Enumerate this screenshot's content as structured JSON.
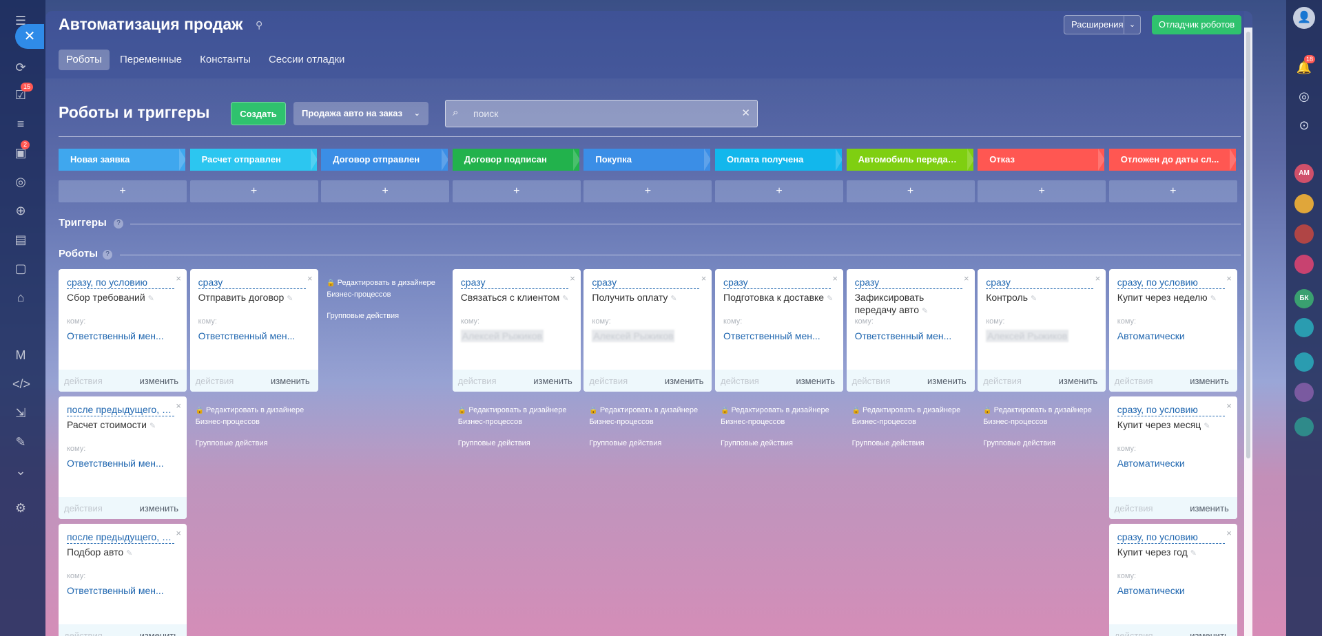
{
  "portal": {
    "close_label": "✕",
    "left_badges": [
      "15",
      "2"
    ],
    "right_badge": "18",
    "right_avatars": [
      "АМ",
      "БК"
    ]
  },
  "header": {
    "title": "Автоматизация продаж",
    "extensions_label": "Расширения",
    "debugger_label": "Отладчик роботов",
    "tabs": [
      {
        "label": "Роботы",
        "active": true
      },
      {
        "label": "Переменные"
      },
      {
        "label": "Константы"
      },
      {
        "label": "Сессии отладки"
      }
    ]
  },
  "toolbar": {
    "section_title": "Роботы и триггеры",
    "create_label": "Создать",
    "category_label": "Продажа авто на заказ",
    "search_placeholder": "поиск"
  },
  "stages": [
    {
      "label": "Новая заявка",
      "color": "#3fa7ee"
    },
    {
      "label": "Расчет отправлен",
      "color": "#2cc6f0"
    },
    {
      "label": "Договор отправлен",
      "color": "#3b8ee6"
    },
    {
      "label": "Договор подписан",
      "color": "#22b24c"
    },
    {
      "label": "Покупка",
      "color": "#3b8ee6"
    },
    {
      "label": "Оплата получена",
      "color": "#12b7ec"
    },
    {
      "label": "Автомобиль передан к...",
      "color": "#7fcf11"
    },
    {
      "label": "Отказ",
      "color": "#ff5752"
    },
    {
      "label": "Отложен до даты сл...",
      "color": "#ff5752"
    }
  ],
  "add_label": "+",
  "sections": {
    "triggers": "Триггеры",
    "robots": "Роботы",
    "help": "?"
  },
  "card_ui": {
    "komu": "кому:",
    "actions": "действия",
    "change": "изменить",
    "delete": "×",
    "edit": "✎"
  },
  "bp_link": "Редактировать в дизайнере Бизнес-процессов",
  "group_link": "Групповые действия",
  "robots": [
    {
      "condition": "сразу, по условию",
      "title": "Сбор требований",
      "responsible": "Ответственный мен..."
    },
    {
      "condition": "сразу",
      "title": "Отправить договор",
      "responsible": "Ответственный мен..."
    },
    {
      "condition": "сразу",
      "title": "Связаться с клиентом",
      "responsible": "Алексей Рыжиков"
    },
    {
      "condition": "сразу",
      "title": "Получить оплату",
      "responsible": "Алексей Рыжиков"
    },
    {
      "condition": "сразу",
      "title": "Подготовка к доставке",
      "responsible": "Ответственный мен..."
    },
    {
      "condition": "сразу",
      "title": "Зафиксировать передачу авто",
      "responsible": "Ответственный мен..."
    },
    {
      "condition": "сразу",
      "title": "Контроль",
      "responsible": "Алексей Рыжиков"
    },
    {
      "condition": "сразу, по условию",
      "title": "Купит через неделю",
      "responsible": "Автоматически"
    },
    {
      "condition": "после предыдущего, п...",
      "title": "Расчет стоимости",
      "responsible": "Ответственный мен..."
    },
    {
      "condition": "сразу, по условию",
      "title": "Купит через месяц",
      "responsible": "Автоматически"
    },
    {
      "condition": "после предыдущего, п...",
      "title": "Подбор авто",
      "responsible": "Ответственный мен..."
    },
    {
      "condition": "сразу, по условию",
      "title": "Купит через год",
      "responsible": "Автоматически"
    }
  ]
}
